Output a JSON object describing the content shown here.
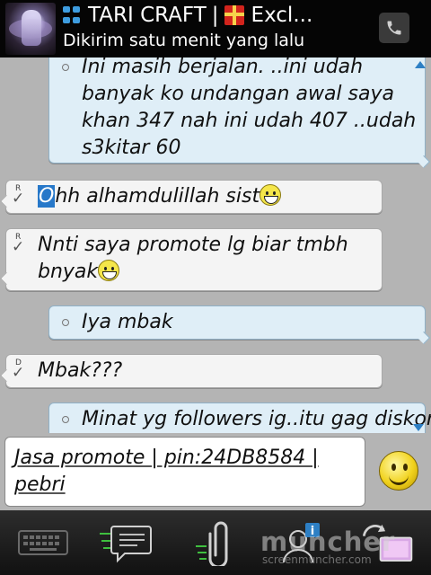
{
  "header": {
    "title": "TARI CRAFT",
    "separator": "|",
    "title_suffix": "Excl...",
    "subtitle": "Dikirim satu menit yang lalu",
    "avatar_icon": "contact-avatar",
    "bbm_icon": "bbm-icon",
    "gift_icon": "gift-icon",
    "call_icon": "phone-icon"
  },
  "messages": [
    {
      "direction": "out",
      "text": "Ini masih berjalan. ..ini udah banyak ko undangan awal saya khan 347 nah ini udah 407 ..udah s3kitar 60"
    },
    {
      "direction": "in",
      "status": "R",
      "text_first": "O",
      "text_rest": "hh alhamdulillah sist",
      "emoticon": "smile"
    },
    {
      "direction": "in",
      "status": "R",
      "text": "Nnti saya promote lg biar tmbh bnyak",
      "emoticon": "smile"
    },
    {
      "direction": "out",
      "text": "Iya mbak"
    },
    {
      "direction": "in",
      "status": "D",
      "text": "Mbak???"
    },
    {
      "direction": "out",
      "text": "Minat yg followers ig..itu gag diskon"
    }
  ],
  "compose": {
    "value_line1": "Jasa promote | pin:24DB8584 |",
    "value_line2": "pebri",
    "emoticon_icon": "smiley-icon"
  },
  "toolbar": {
    "items": [
      "keyboard-icon",
      "chat-icon",
      "attachment-icon",
      "contact-info-icon",
      "switch-app-icon"
    ]
  },
  "watermark": {
    "text": "muncher",
    "sub": "screenmuncher.com"
  },
  "colors": {
    "bubble_out": "#dfeef7",
    "bubble_in": "#f4f4f4",
    "accent": "#2d7fc4",
    "background": "#b4b4b4"
  }
}
